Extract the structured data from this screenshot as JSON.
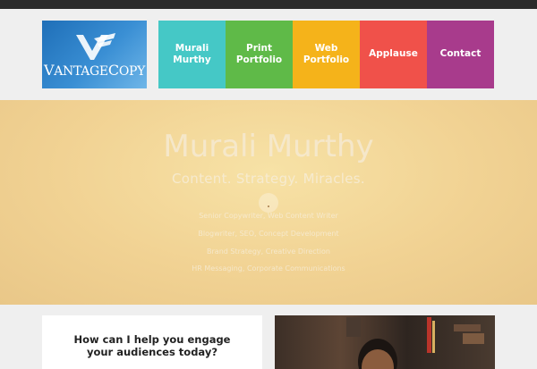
{
  "logo": {
    "brand_text_1": "V",
    "brand_text_2": "ANTAGE",
    "brand_text_3": "C",
    "brand_text_4": "OPY"
  },
  "nav": {
    "items": [
      {
        "label": "Murali\nMurthy",
        "color": "#45c8c6",
        "width": 75
      },
      {
        "label": "Print\nPortfolio",
        "color": "#5fba48",
        "width": 75
      },
      {
        "label": "Web Portfolio",
        "color": "#f5b31a",
        "width": 75
      },
      {
        "label": "Applause",
        "color": "#f0514a",
        "width": 75
      },
      {
        "label": "Contact",
        "color": "#a83b8c",
        "width": 75
      }
    ]
  },
  "hero": {
    "title": "Murali Murthy",
    "subtitle": "Content. Strategy. Miracles.",
    "lines": [
      "Senior Copywriter, Web Content Writer",
      "Blogwriter, SEO, Concept Development",
      "Brand Strategy, Creative Direction",
      "HR Messaging, Corporate Communications"
    ]
  },
  "card": {
    "title": "How can I help you engage\nyour audiences today?"
  }
}
